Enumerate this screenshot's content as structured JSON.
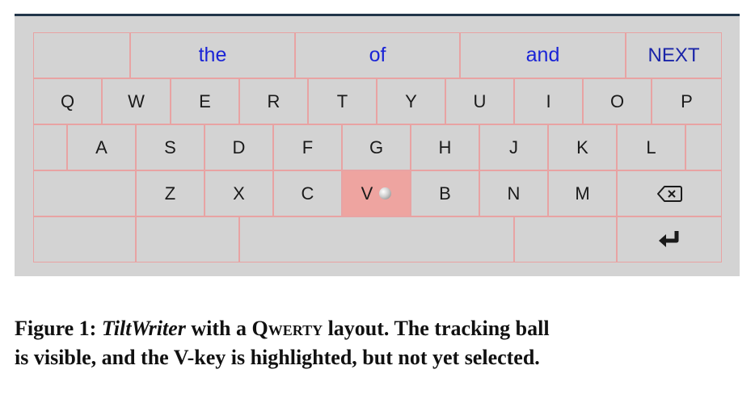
{
  "keyboard": {
    "suggestions": [
      "the",
      "of",
      "and"
    ],
    "next_label": "NEXT",
    "row1": [
      "Q",
      "W",
      "E",
      "R",
      "T",
      "Y",
      "U",
      "I",
      "O",
      "P"
    ],
    "row2": [
      "A",
      "S",
      "D",
      "F",
      "G",
      "H",
      "J",
      "K",
      "L"
    ],
    "row3": [
      "Z",
      "X",
      "C",
      "V",
      "B",
      "N",
      "M"
    ],
    "highlighted_key": "V",
    "backspace_icon": "backspace-icon",
    "enter_icon": "enter-icon"
  },
  "caption": {
    "prefix": "Figure 1: ",
    "app_name": "TiltWriter",
    "middle": " with a ",
    "layout_name": "Qwerty",
    "line1_end": " layout. The tracking ball",
    "line2": "is visible, and the V-key is highlighted, but not yet selected."
  }
}
